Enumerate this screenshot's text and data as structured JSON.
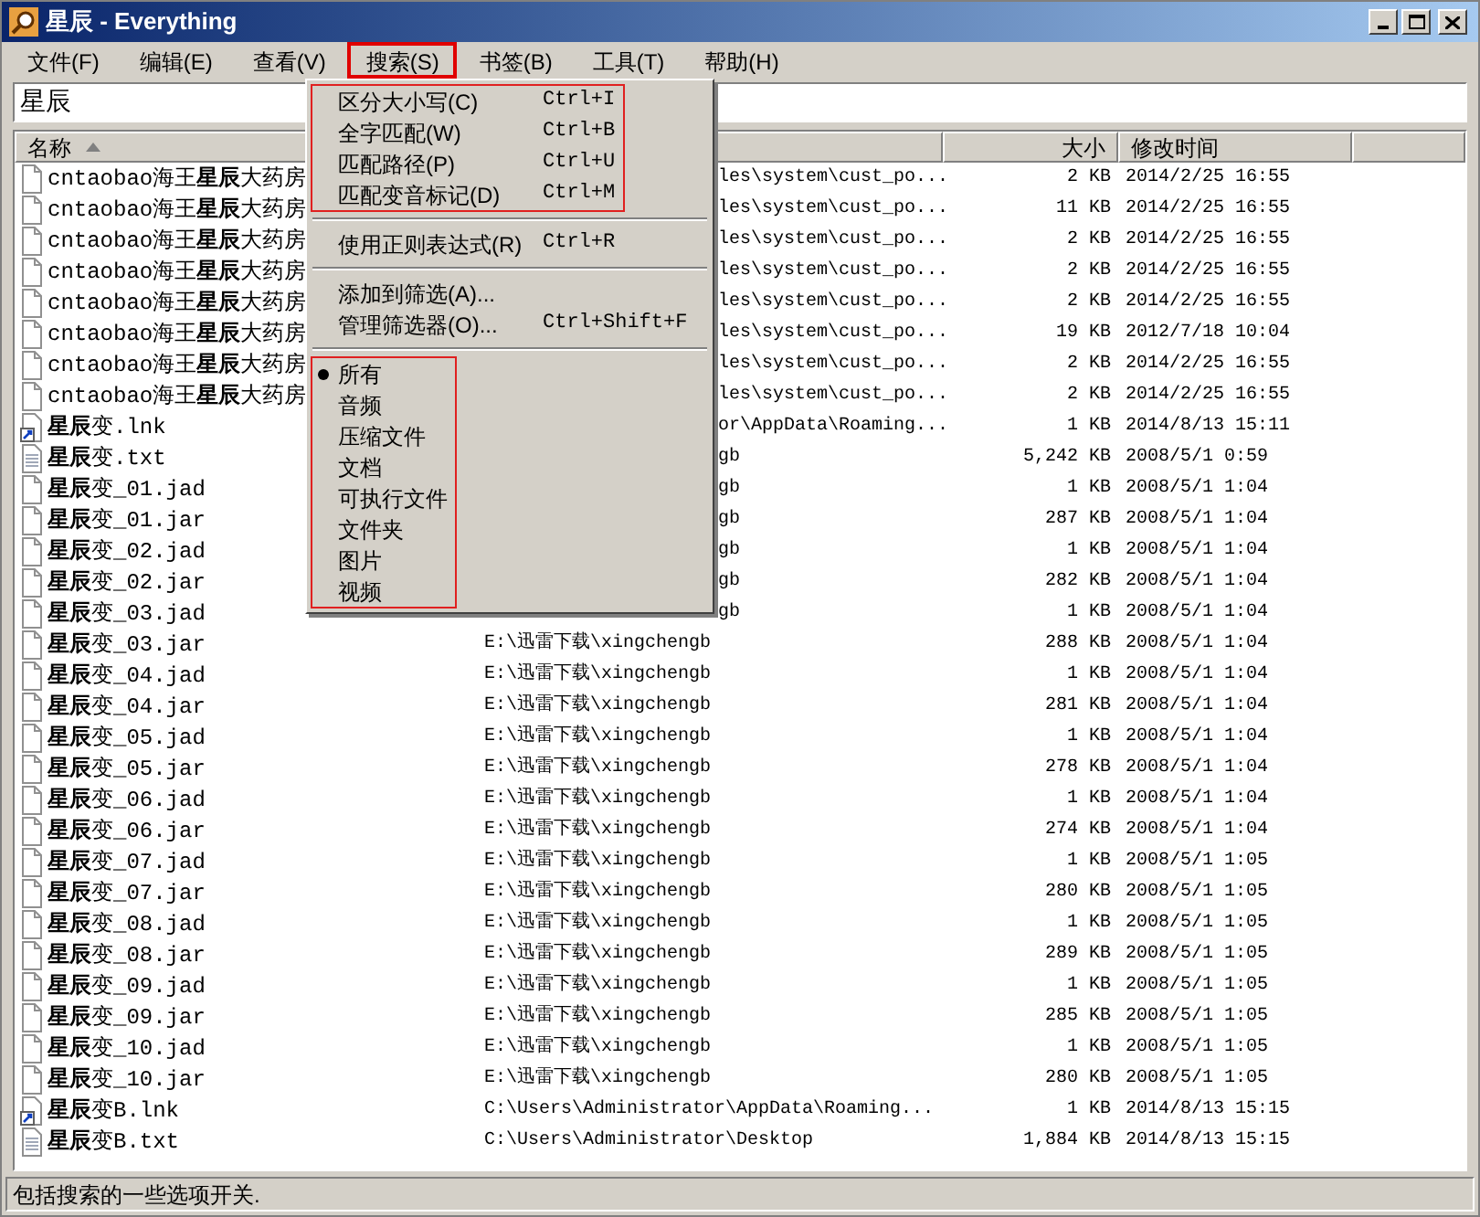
{
  "window": {
    "title": "星辰 - Everything"
  },
  "menubar": [
    {
      "label": "文件(F)",
      "selected": false
    },
    {
      "label": "编辑(E)",
      "selected": false
    },
    {
      "label": "查看(V)",
      "selected": false
    },
    {
      "label": "搜索(S)",
      "selected": true
    },
    {
      "label": "书签(B)",
      "selected": false
    },
    {
      "label": "工具(T)",
      "selected": false
    },
    {
      "label": "帮助(H)",
      "selected": false
    }
  ],
  "search": {
    "value": "星辰"
  },
  "columns": [
    {
      "label": "名称",
      "sorted": true
    },
    {
      "label": "大小",
      "sorted": false
    },
    {
      "label": "修改时间",
      "sorted": false
    }
  ],
  "rows": [
    {
      "kind": "file",
      "name": "cntaobao海王**星辰**大药房",
      "path": "les\\system\\cust_po...",
      "size": "2 KB",
      "modified": "2014/2/25 16:55"
    },
    {
      "kind": "file",
      "name": "cntaobao海王**星辰**大药房",
      "path": "les\\system\\cust_po...",
      "size": "11 KB",
      "modified": "2014/2/25 16:55"
    },
    {
      "kind": "file",
      "name": "cntaobao海王**星辰**大药房",
      "path": "les\\system\\cust_po...",
      "size": "2 KB",
      "modified": "2014/2/25 16:55"
    },
    {
      "kind": "file",
      "name": "cntaobao海王**星辰**大药房",
      "path": "les\\system\\cust_po...",
      "size": "2 KB",
      "modified": "2014/2/25 16:55"
    },
    {
      "kind": "file",
      "name": "cntaobao海王**星辰**大药房",
      "path": "les\\system\\cust_po...",
      "size": "2 KB",
      "modified": "2014/2/25 16:55"
    },
    {
      "kind": "file",
      "name": "cntaobao海王**星辰**大药房",
      "path": "les\\system\\cust_po...",
      "size": "19 KB",
      "modified": "2012/7/18 10:04"
    },
    {
      "kind": "file",
      "name": "cntaobao海王**星辰**大药房",
      "path": "les\\system\\cust_po...",
      "size": "2 KB",
      "modified": "2014/2/25 16:55"
    },
    {
      "kind": "file",
      "name": "cntaobao海王**星辰**大药房",
      "path": "les\\system\\cust_po...",
      "size": "2 KB",
      "modified": "2014/2/25 16:55"
    },
    {
      "kind": "link",
      "name": "**星辰**变.lnk",
      "path": "or\\AppData\\Roaming...",
      "size": "1 KB",
      "modified": "2014/8/13 15:11"
    },
    {
      "kind": "text",
      "name": "**星辰**变.txt",
      "path": "gb",
      "size": "5,242 KB",
      "modified": "2008/5/1 0:59"
    },
    {
      "kind": "file",
      "name": "**星辰**变_01.jad",
      "path": "gb",
      "size": "1 KB",
      "modified": "2008/5/1 1:04"
    },
    {
      "kind": "file",
      "name": "**星辰**变_01.jar",
      "path": "gb",
      "size": "287 KB",
      "modified": "2008/5/1 1:04"
    },
    {
      "kind": "file",
      "name": "**星辰**变_02.jad",
      "path": "gb",
      "size": "1 KB",
      "modified": "2008/5/1 1:04"
    },
    {
      "kind": "file",
      "name": "**星辰**变_02.jar",
      "path": "gb",
      "size": "282 KB",
      "modified": "2008/5/1 1:04"
    },
    {
      "kind": "file",
      "name": "**星辰**变_03.jad",
      "path": "gb",
      "size": "1 KB",
      "modified": "2008/5/1 1:04"
    },
    {
      "kind": "file",
      "name": "**星辰**变_03.jar",
      "path": "E:\\迅雷下载\\xingchengb",
      "size": "288 KB",
      "modified": "2008/5/1 1:04"
    },
    {
      "kind": "file",
      "name": "**星辰**变_04.jad",
      "path": "E:\\迅雷下载\\xingchengb",
      "size": "1 KB",
      "modified": "2008/5/1 1:04"
    },
    {
      "kind": "file",
      "name": "**星辰**变_04.jar",
      "path": "E:\\迅雷下载\\xingchengb",
      "size": "281 KB",
      "modified": "2008/5/1 1:04"
    },
    {
      "kind": "file",
      "name": "**星辰**变_05.jad",
      "path": "E:\\迅雷下载\\xingchengb",
      "size": "1 KB",
      "modified": "2008/5/1 1:04"
    },
    {
      "kind": "file",
      "name": "**星辰**变_05.jar",
      "path": "E:\\迅雷下载\\xingchengb",
      "size": "278 KB",
      "modified": "2008/5/1 1:04"
    },
    {
      "kind": "file",
      "name": "**星辰**变_06.jad",
      "path": "E:\\迅雷下载\\xingchengb",
      "size": "1 KB",
      "modified": "2008/5/1 1:04"
    },
    {
      "kind": "file",
      "name": "**星辰**变_06.jar",
      "path": "E:\\迅雷下载\\xingchengb",
      "size": "274 KB",
      "modified": "2008/5/1 1:04"
    },
    {
      "kind": "file",
      "name": "**星辰**变_07.jad",
      "path": "E:\\迅雷下载\\xingchengb",
      "size": "1 KB",
      "modified": "2008/5/1 1:05"
    },
    {
      "kind": "file",
      "name": "**星辰**变_07.jar",
      "path": "E:\\迅雷下载\\xingchengb",
      "size": "280 KB",
      "modified": "2008/5/1 1:05"
    },
    {
      "kind": "file",
      "name": "**星辰**变_08.jad",
      "path": "E:\\迅雷下载\\xingchengb",
      "size": "1 KB",
      "modified": "2008/5/1 1:05"
    },
    {
      "kind": "file",
      "name": "**星辰**变_08.jar",
      "path": "E:\\迅雷下载\\xingchengb",
      "size": "289 KB",
      "modified": "2008/5/1 1:05"
    },
    {
      "kind": "file",
      "name": "**星辰**变_09.jad",
      "path": "E:\\迅雷下载\\xingchengb",
      "size": "1 KB",
      "modified": "2008/5/1 1:05"
    },
    {
      "kind": "file",
      "name": "**星辰**变_09.jar",
      "path": "E:\\迅雷下载\\xingchengb",
      "size": "285 KB",
      "modified": "2008/5/1 1:05"
    },
    {
      "kind": "file",
      "name": "**星辰**变_10.jad",
      "path": "E:\\迅雷下载\\xingchengb",
      "size": "1 KB",
      "modified": "2008/5/1 1:05"
    },
    {
      "kind": "file",
      "name": "**星辰**变_10.jar",
      "path": "E:\\迅雷下载\\xingchengb",
      "size": "280 KB",
      "modified": "2008/5/1 1:05"
    },
    {
      "kind": "link",
      "name": "**星辰**变B.lnk",
      "path": "C:\\Users\\Administrator\\AppData\\Roaming...",
      "size": "1 KB",
      "modified": "2014/8/13 15:15"
    },
    {
      "kind": "text",
      "name": "**星辰**变B.txt",
      "path": "C:\\Users\\Administrator\\Desktop",
      "size": "1,884 KB",
      "modified": "2014/8/13 15:15"
    }
  ],
  "dropdown": {
    "sections": [
      {
        "framed": true,
        "items": [
          {
            "kind": "command",
            "label": "区分大小写(C)",
            "shortcut": "Ctrl+I"
          },
          {
            "kind": "command",
            "label": "全字匹配(W)",
            "shortcut": "Ctrl+B"
          },
          {
            "kind": "command",
            "label": "匹配路径(P)",
            "shortcut": "Ctrl+U"
          },
          {
            "kind": "command",
            "label": "匹配变音标记(D)",
            "shortcut": "Ctrl+M"
          }
        ]
      },
      {
        "framed": false,
        "items": [
          {
            "kind": "command",
            "label": "使用正则表达式(R)",
            "shortcut": "Ctrl+R"
          }
        ]
      },
      {
        "framed": false,
        "items": [
          {
            "kind": "command",
            "label": "添加到筛选(A)..."
          },
          {
            "kind": "command",
            "label": "管理筛选器(O)...",
            "shortcut": "Ctrl+Shift+F"
          }
        ]
      },
      {
        "framed": true,
        "items": [
          {
            "kind": "radio",
            "label": "所有",
            "selected": true
          },
          {
            "kind": "radio",
            "label": "音频",
            "selected": false
          },
          {
            "kind": "radio",
            "label": "压缩文件",
            "selected": false
          },
          {
            "kind": "radio",
            "label": "文档",
            "selected": false
          },
          {
            "kind": "radio",
            "label": "可执行文件",
            "selected": false
          },
          {
            "kind": "radio",
            "label": "文件夹",
            "selected": false
          },
          {
            "kind": "radio",
            "label": "图片",
            "selected": false
          },
          {
            "kind": "radio",
            "label": "视频",
            "selected": false
          }
        ]
      }
    ]
  },
  "status_bar": "包括搜索的一些选项开关."
}
